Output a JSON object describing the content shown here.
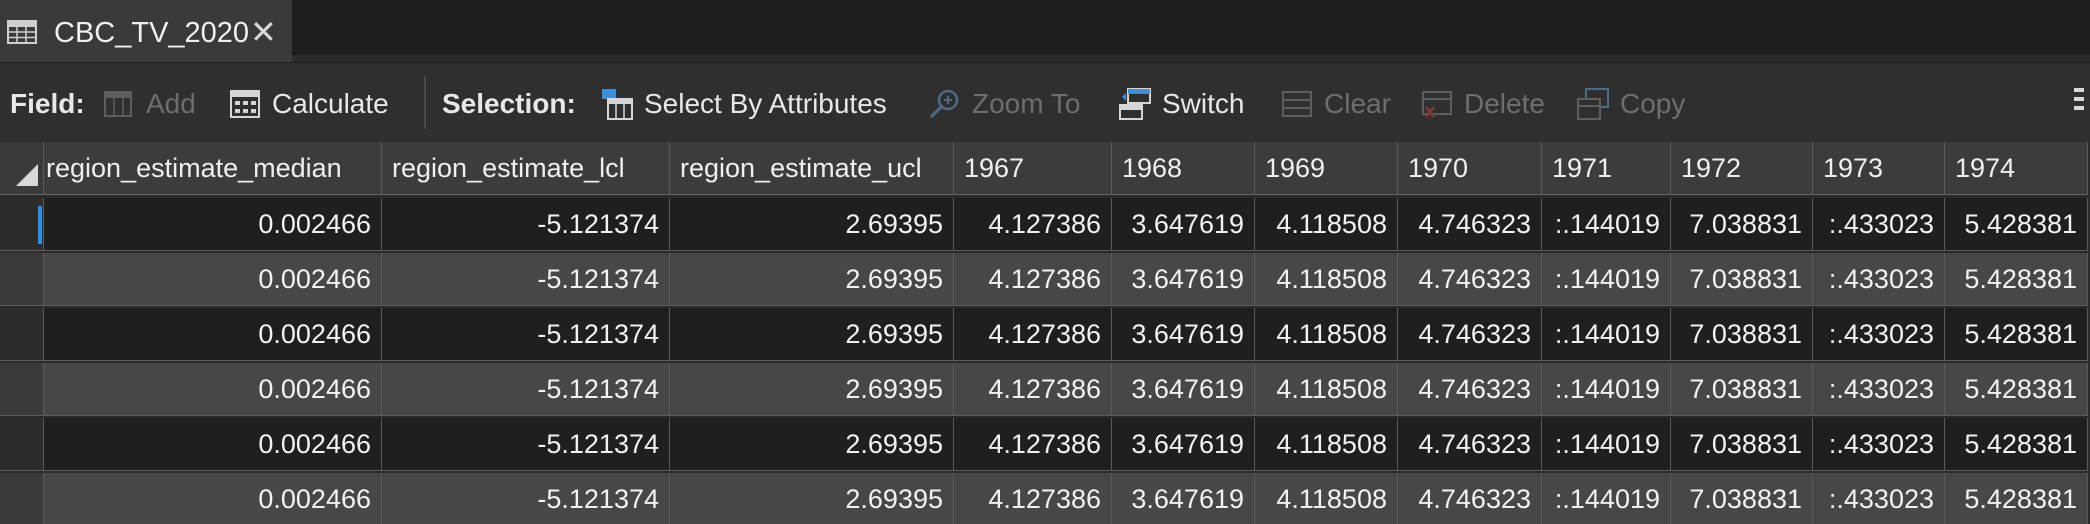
{
  "tab": {
    "title": "CBC_TV_2020",
    "close_glyph": "✕",
    "icon": "table-icon"
  },
  "toolbar": {
    "field_label": "Field:",
    "add_label": "Add",
    "calculate_label": "Calculate",
    "selection_label": "Selection:",
    "select_by_attributes_label": "Select By Attributes",
    "zoom_to_label": "Zoom To",
    "switch_label": "Switch",
    "clear_label": "Clear",
    "delete_label": "Delete",
    "copy_label": "Copy"
  },
  "table": {
    "columns": [
      "region_estimate_median",
      "region_estimate_lcl",
      "region_estimate_ucl",
      "1967",
      "1968",
      "1969",
      "1970",
      "1971",
      "1972",
      "1973",
      "1974"
    ],
    "rows": [
      [
        "0.002466",
        "-5.121374",
        "2.69395",
        "4.127386",
        "3.647619",
        "4.118508",
        "4.746323",
        ":.144019",
        "7.038831",
        ":.433023",
        "5.428381"
      ],
      [
        "0.002466",
        "-5.121374",
        "2.69395",
        "4.127386",
        "3.647619",
        "4.118508",
        "4.746323",
        ":.144019",
        "7.038831",
        ":.433023",
        "5.428381"
      ],
      [
        "0.002466",
        "-5.121374",
        "2.69395",
        "4.127386",
        "3.647619",
        "4.118508",
        "4.746323",
        ":.144019",
        "7.038831",
        ":.433023",
        "5.428381"
      ],
      [
        "0.002466",
        "-5.121374",
        "2.69395",
        "4.127386",
        "3.647619",
        "4.118508",
        "4.746323",
        ":.144019",
        "7.038831",
        ":.433023",
        "5.428381"
      ],
      [
        "0.002466",
        "-5.121374",
        "2.69395",
        "4.127386",
        "3.647619",
        "4.118508",
        "4.746323",
        ":.144019",
        "7.038831",
        ":.433023",
        "5.428381"
      ],
      [
        "0.002466",
        "-5.121374",
        "2.69395",
        "4.127386",
        "3.647619",
        "4.118508",
        "4.746323",
        ":.144019",
        "7.038831",
        ":.433023",
        "5.428381"
      ]
    ]
  },
  "colors": {
    "accent": "#2a8ee6",
    "background": "#2b2b2b",
    "row_dark": "#1f1f1f",
    "row_light": "#474747"
  }
}
